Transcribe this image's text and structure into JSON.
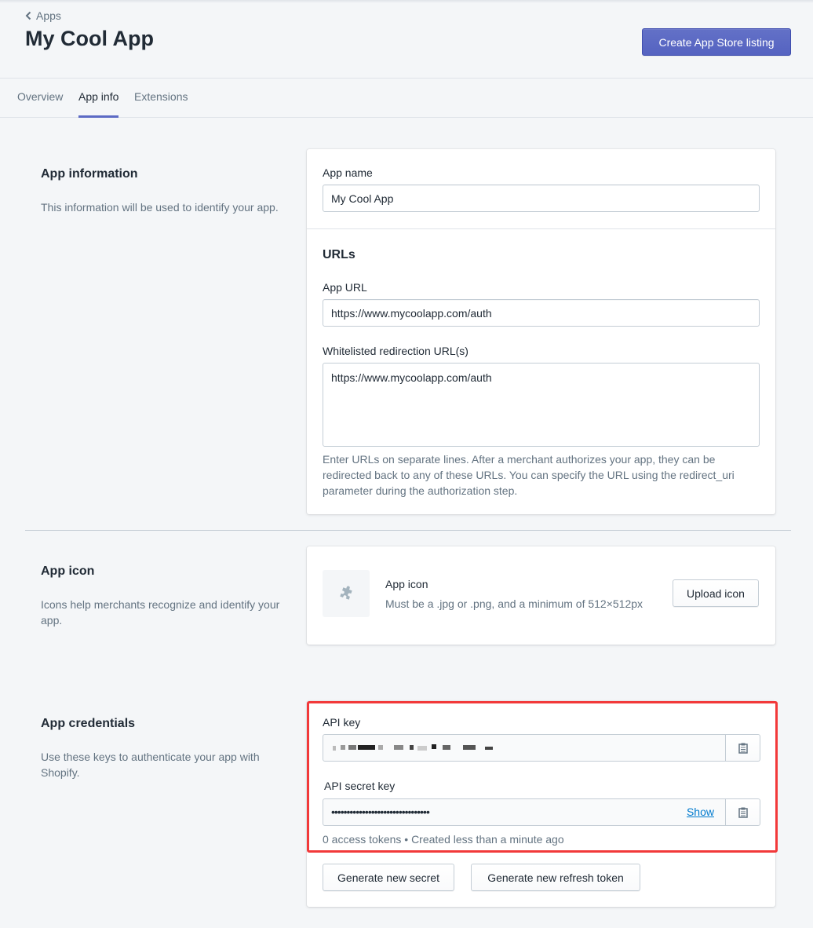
{
  "header": {
    "breadcrumb": "Apps",
    "title": "My Cool App",
    "primary_action": "Create App Store listing"
  },
  "tabs": [
    {
      "label": "Overview",
      "active": false
    },
    {
      "label": "App info",
      "active": true
    },
    {
      "label": "Extensions",
      "active": false
    }
  ],
  "app_information": {
    "title": "App information",
    "description": "This information will be used to identify your app.",
    "app_name_label": "App name",
    "app_name_value": "My Cool App",
    "urls_heading": "URLs",
    "app_url_label": "App URL",
    "app_url_value": "https://www.mycoolapp.com/auth",
    "redirect_label": "Whitelisted redirection URL(s)",
    "redirect_value": "https://www.mycoolapp.com/auth",
    "redirect_help": "Enter URLs on separate lines. After a merchant authorizes your app, they can be redirected back to any of these URLs. You can specify the URL using the redirect_uri parameter during the authorization step."
  },
  "app_icon": {
    "title": "App icon",
    "description": "Icons help merchants recognize and identify your app.",
    "card_title": "App icon",
    "card_help": "Must be a .jpg or .png, and a minimum of 512×512px",
    "upload_button": "Upload icon"
  },
  "app_credentials": {
    "title": "App credentials",
    "description": "Use these keys to authenticate your app with Shopify.",
    "api_key_label": "API key",
    "api_key_value": "(redacted)",
    "api_secret_label": "API secret key",
    "api_secret_value": "••••••••••••••••••••••••••••••••",
    "show_link": "Show",
    "meta": "0 access tokens • Created less than a minute ago",
    "generate_secret_button": "Generate new secret",
    "generate_refresh_button": "Generate new refresh token"
  },
  "colors": {
    "primary": "#5c6ac4",
    "highlight": "#f2393a",
    "link": "#007ace"
  }
}
